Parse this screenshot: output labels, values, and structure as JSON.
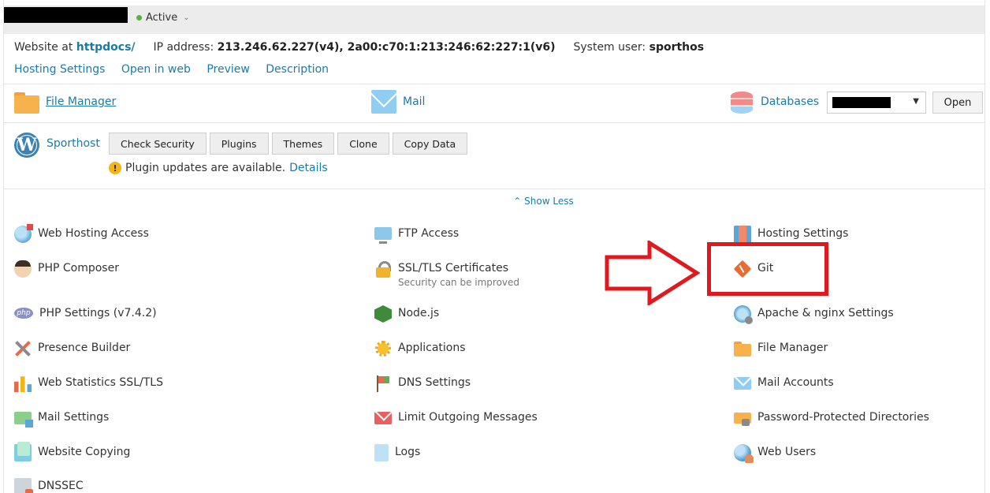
{
  "header": {
    "status_label": "Active",
    "status_color": "#55b63a"
  },
  "info": {
    "website_at_label": "Website at",
    "website_at_value": "httpdocs/",
    "ip_label": "IP address:",
    "ip_value": "213.246.62.227(v4), 2a00:c70:1:213:246:62:227:1(v6)",
    "sysuser_label": "System user:",
    "sysuser_value": "sporthos"
  },
  "nav": [
    "Hosting Settings",
    "Open in web",
    "Preview",
    "Description"
  ],
  "quick": {
    "file_manager": "File Manager",
    "mail": "Mail",
    "databases": "Databases",
    "open": "Open"
  },
  "wordpress": {
    "name": "Sporthost",
    "buttons": [
      "Check Security",
      "Plugins",
      "Themes",
      "Clone",
      "Copy Data"
    ],
    "notice": "Plugin updates are available.",
    "notice_link": "Details"
  },
  "show_less": "Show Less",
  "tools": {
    "col1": [
      {
        "label": "Web Hosting Access",
        "icon": "globe-icon"
      },
      {
        "label": "PHP Composer",
        "icon": "composer-icon"
      },
      {
        "label": "PHP Settings (v7.4.2)",
        "icon": "php-icon"
      },
      {
        "label": "Presence Builder",
        "icon": "tools-icon"
      },
      {
        "label": "Web Statistics SSL/TLS",
        "icon": "statistics-icon"
      },
      {
        "label": "Mail Settings",
        "icon": "mail-settings-icon"
      },
      {
        "label": "Website Copying",
        "icon": "copy-icon"
      },
      {
        "label": "DNSSEC",
        "icon": "dnssec-icon"
      }
    ],
    "col2": [
      {
        "label": "FTP Access",
        "icon": "ftp-icon"
      },
      {
        "label": "SSL/TLS Certificates",
        "sub": "Security can be improved",
        "icon": "lock-icon"
      },
      {
        "label": "Node.js",
        "icon": "nodejs-icon"
      },
      {
        "label": "Applications",
        "icon": "gear-icon"
      },
      {
        "label": "DNS Settings",
        "icon": "flags-icon"
      },
      {
        "label": "Limit Outgoing Messages",
        "icon": "mail-limit-icon"
      },
      {
        "label": "Logs",
        "icon": "logs-icon"
      }
    ],
    "col3": [
      {
        "label": "Hosting Settings",
        "icon": "hosting-settings-icon"
      },
      {
        "label": "Git",
        "icon": "git-icon"
      },
      {
        "label": "Apache & nginx Settings",
        "icon": "apache-icon"
      },
      {
        "label": "File Manager",
        "icon": "folder-icon"
      },
      {
        "label": "Mail Accounts",
        "icon": "mail-icon"
      },
      {
        "label": "Password-Protected Directories",
        "icon": "folder-lock-icon"
      },
      {
        "label": "Web Users",
        "icon": "web-users-icon"
      }
    ]
  },
  "annotation_color": "#e0191f"
}
